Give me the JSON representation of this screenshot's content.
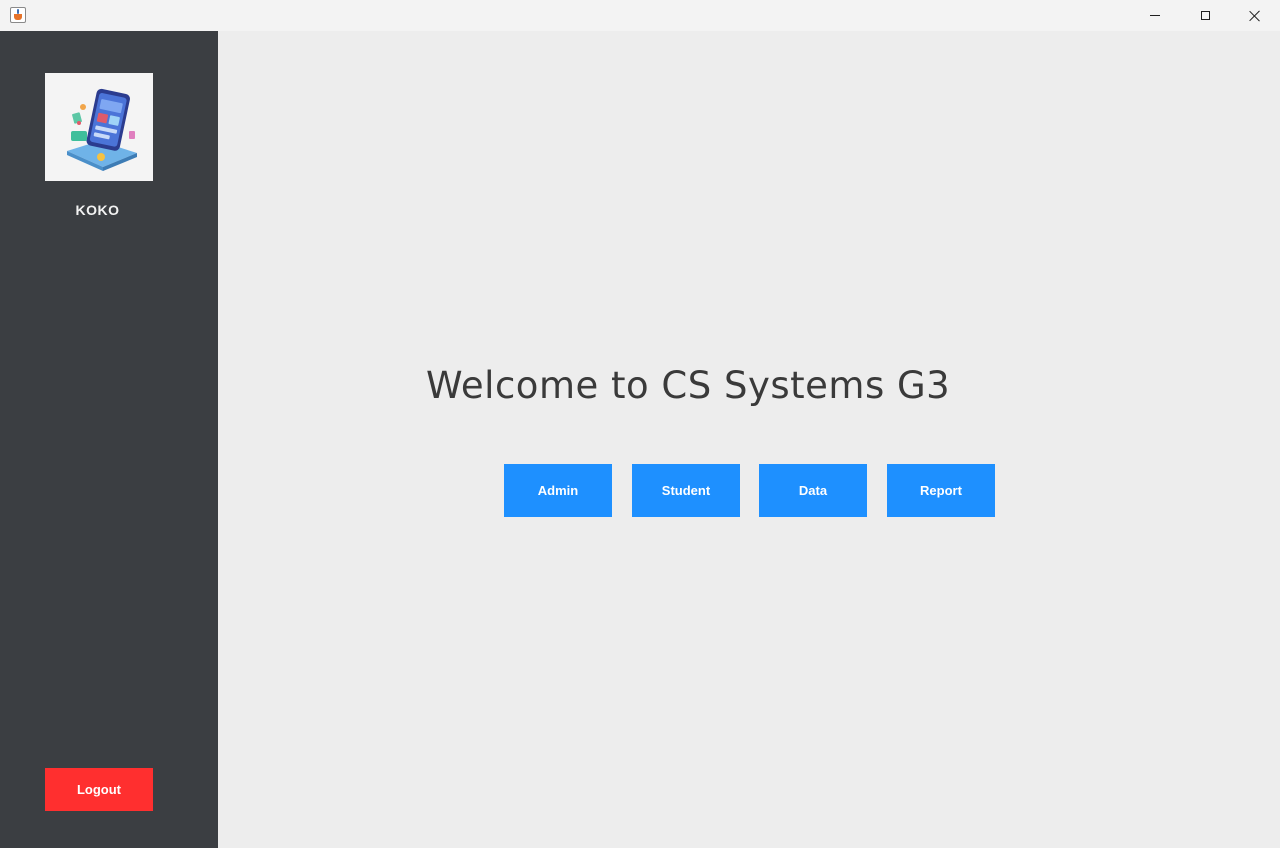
{
  "window": {
    "icon": "java-cup-icon",
    "controls": {
      "minimize_icon": "minimize-icon",
      "maximize_icon": "maximize-icon",
      "close_icon": "close-icon"
    }
  },
  "sidebar": {
    "background": "#3b3e42",
    "avatar_icon": "tablet-illustration-icon",
    "username": "KOKO",
    "logout_label": "Logout",
    "logout_color": "#ff2f2f"
  },
  "main": {
    "background": "#ededed",
    "welcome_text": "Welcome to CS Systems G3",
    "button_color": "#1e90ff",
    "buttons": [
      {
        "label": "Admin"
      },
      {
        "label": "Student"
      },
      {
        "label": "Data"
      },
      {
        "label": "Report"
      }
    ]
  }
}
